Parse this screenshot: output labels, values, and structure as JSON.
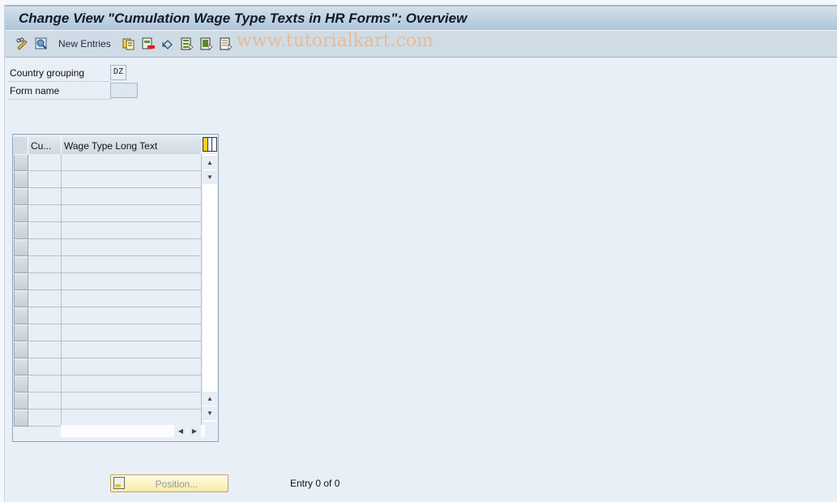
{
  "window": {
    "title": "Change View \"Cumulation Wage Type Texts in HR Forms\": Overview"
  },
  "toolbar": {
    "items": [
      {
        "icon": "display-change-icon"
      },
      {
        "icon": "find-icon"
      },
      {
        "label": "New Entries"
      },
      {
        "icon": "copy-as-icon"
      },
      {
        "icon": "delete-icon"
      },
      {
        "icon": "undo-change-icon"
      },
      {
        "icon": "select-all-icon"
      },
      {
        "icon": "select-block-icon"
      },
      {
        "icon": "deselect-all-icon"
      }
    ],
    "new_entries_label": "New Entries"
  },
  "watermark": "www.tutorialkart.com",
  "fields": {
    "country_grouping": {
      "label": "Country grouping",
      "value": "DZ"
    },
    "form_name": {
      "label": "Form name",
      "value": ""
    }
  },
  "table": {
    "columns": [
      {
        "label": "Cu..."
      },
      {
        "label": "Wage Type Long Text"
      }
    ],
    "visible_rows": 16,
    "rows": []
  },
  "footer": {
    "position_label": "Position...",
    "entry_info": "Entry 0 of 0"
  }
}
